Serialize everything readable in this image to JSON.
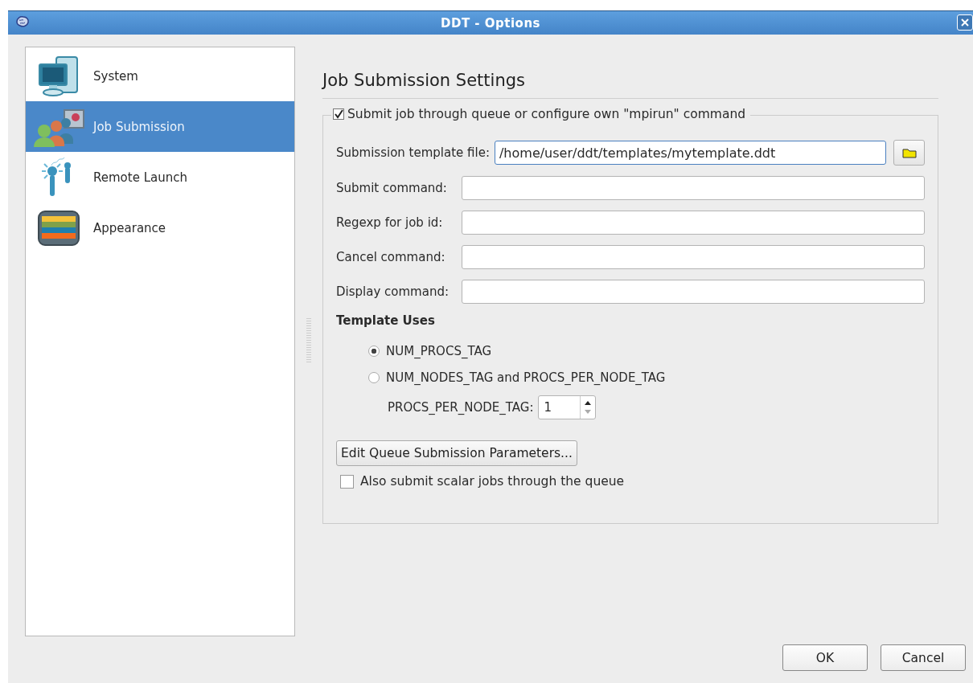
{
  "window": {
    "title": "DDT - Options"
  },
  "sidebar": {
    "items": [
      {
        "label": "System",
        "kind": "system",
        "selected": false
      },
      {
        "label": "Job Submission",
        "kind": "job",
        "selected": true
      },
      {
        "label": "Remote Launch",
        "kind": "remote",
        "selected": false
      },
      {
        "label": "Appearance",
        "kind": "appearance",
        "selected": false
      }
    ]
  },
  "page": {
    "title": "Job Submission Settings",
    "group": {
      "label": "Submit job through queue or configure own \"mpirun\" command",
      "checked": true
    },
    "fields": [
      {
        "label": "Submission template file:",
        "value": "/home/user/ddt/templates/mytemplate.ddt",
        "focused": true,
        "browse": true
      },
      {
        "label": "Submit command:",
        "focused": false,
        "browse": false
      },
      {
        "label": "Regexp for job id:",
        "focused": false,
        "browse": false
      },
      {
        "label": "Cancel command:",
        "focused": false,
        "browse": false
      },
      {
        "label": "Display command:",
        "focused": false,
        "browse": false
      }
    ],
    "template_uses": {
      "heading": "Template Uses",
      "options": [
        {
          "label": "NUM_PROCS_TAG",
          "selected": true
        },
        {
          "label": "NUM_NODES_TAG and PROCS_PER_NODE_TAG",
          "selected": false
        }
      ],
      "spin": {
        "label": "PROCS_PER_NODE_TAG:",
        "value": "1"
      }
    },
    "edit_button": "Edit Queue Submission Parameters...",
    "scalar": {
      "label": "Also submit scalar jobs through the queue",
      "checked": false
    }
  },
  "buttons": [
    "OK",
    "Cancel"
  ]
}
